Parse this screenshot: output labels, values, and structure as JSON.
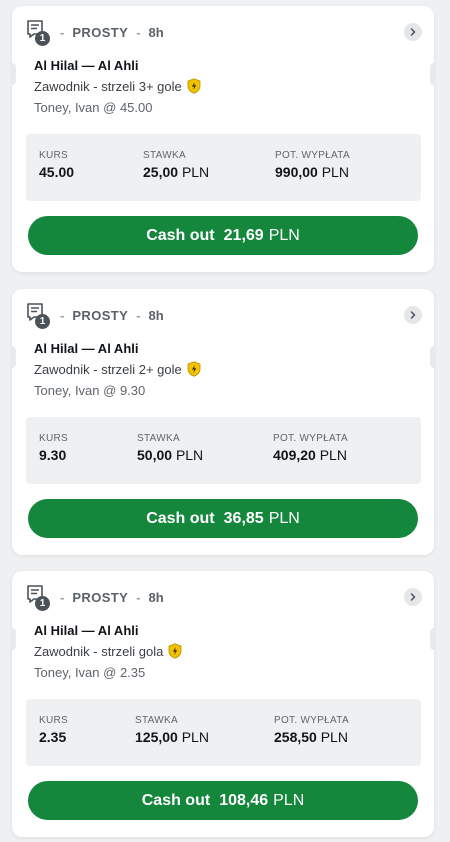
{
  "bets": [
    {
      "slip_count": "1",
      "type": "PROSTY",
      "time": "8h",
      "match": "Al Hilal — Al Ahli",
      "market": "Zawodnik - strzeli 3+ gole",
      "selection": "Toney, Ivan @ 45.00",
      "odds_label": "KURS",
      "odds": "45.00",
      "stake_label": "STAWKA",
      "stake_amount": "25,00",
      "stake_currency": "PLN",
      "payout_label": "POT. WYPŁATA",
      "payout_amount": "990,00",
      "payout_currency": "PLN",
      "cashout_label": "Cash out",
      "cashout_amount": "21,69",
      "cashout_currency": "PLN"
    },
    {
      "slip_count": "1",
      "type": "PROSTY",
      "time": "8h",
      "match": "Al Hilal — Al Ahli",
      "market": "Zawodnik - strzeli 2+ gole",
      "selection": "Toney, Ivan @ 9.30",
      "odds_label": "KURS",
      "odds": "9.30",
      "stake_label": "STAWKA",
      "stake_amount": "50,00",
      "stake_currency": "PLN",
      "payout_label": "POT. WYPŁATA",
      "payout_amount": "409,20",
      "payout_currency": "PLN",
      "cashout_label": "Cash out",
      "cashout_amount": "36,85",
      "cashout_currency": "PLN"
    },
    {
      "slip_count": "1",
      "type": "PROSTY",
      "time": "8h",
      "match": "Al Hilal — Al Ahli",
      "market": "Zawodnik - strzeli gola",
      "selection": "Toney, Ivan @ 2.35",
      "odds_label": "KURS",
      "odds": "2.35",
      "stake_label": "STAWKA",
      "stake_amount": "125,00",
      "stake_currency": "PLN",
      "payout_label": "POT. WYPŁATA",
      "payout_amount": "258,50",
      "payout_currency": "PLN",
      "cashout_label": "Cash out",
      "cashout_amount": "108,46",
      "cashout_currency": "PLN"
    }
  ],
  "header_separator": "-",
  "icons": {
    "ticket": "bet-slip-icon",
    "expand": "chevron-right-icon",
    "boost": "shield-boost-icon"
  },
  "colors": {
    "cashout_green": "#14873d",
    "boost_yellow": "#f2c200"
  }
}
